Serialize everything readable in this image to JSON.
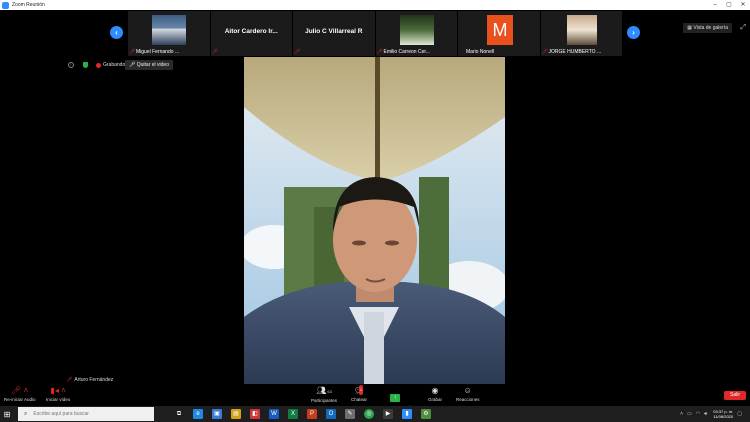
{
  "window": {
    "title": "Zoom Reunión",
    "controls": [
      "–",
      "▢",
      "✕"
    ]
  },
  "gallery": {
    "view_label": "Vista de galería",
    "participants": [
      {
        "display": "Miguel Fernando ...",
        "type": "photo"
      },
      {
        "display": "Aitor Cardero Ir...",
        "type": "name"
      },
      {
        "display": "Julio C Villarreal R",
        "type": "name"
      },
      {
        "display": "Emilio Carreon Cer...",
        "type": "photo"
      },
      {
        "display": "Mario Nonell",
        "type": "initial",
        "initial": "M"
      },
      {
        "display": "JORGE HUMBERTO ...",
        "type": "photo"
      }
    ]
  },
  "status": {
    "recording": "Grabando",
    "stop_video_tooltip": "Quitar el video"
  },
  "self_view": {
    "name": "Arturo Fernández"
  },
  "toolbar": {
    "mic_label": "Re-iniciar Audio",
    "video_label": "Iniciar vídeo",
    "participants_label": "Participantes",
    "participants_count": "63",
    "chat_label": "Chatear",
    "chat_badge": "1",
    "share_label": "Compartir pantalla",
    "record_label": "Grabar",
    "reactions_label": "Reacciones",
    "leave_label": "Salir"
  },
  "taskbar": {
    "search_placeholder": "Escribe aquí para buscar",
    "time": "03:37 p. m.",
    "date": "11/08/2020"
  },
  "colors": {
    "zoom_blue": "#2d8cff",
    "muted_red": "#e02828",
    "share_green": "#2bb34a",
    "initial_tile": "#e8511d"
  }
}
